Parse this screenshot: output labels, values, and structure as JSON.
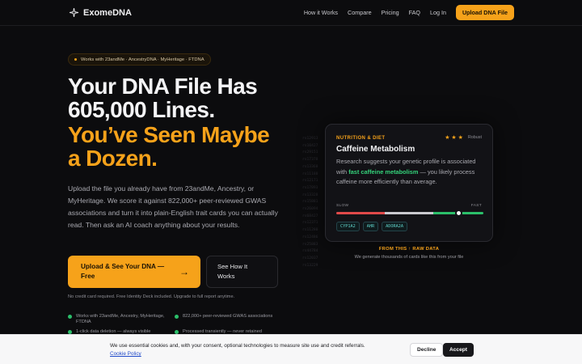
{
  "nav": {
    "brand": "ExomeDNA",
    "links": [
      "How it Works",
      "Compare",
      "Pricing",
      "FAQ",
      "Log In"
    ],
    "cta": "Upload DNA File"
  },
  "hero": {
    "badge": "Works with 23andMe · AncestryDNA · MyHeritage · FTDNA",
    "title_line1": "Your DNA File Has",
    "title_line2": "605,000 Lines.",
    "accent_line1": "You’ve Seen Maybe",
    "accent_line2": "a Dozen.",
    "lede": "Upload the file you already have from 23andMe, Ancestry, or MyHeritage. We score it against 822,000+ peer-reviewed GWAS associations and turn it into plain-English trait cards you can actually read. Then ask an AI coach anything about your results.",
    "primary_cta": "Upload & See Your DNA — Free",
    "secondary_cta": "See How It Works",
    "note": "No credit card required. Free Identity Deck included. Upgrade to full report anytime.",
    "bullets": [
      "Works with 23andMe, Ancestry, MyHeritage, FTDNA",
      "822,000+ peer-reviewed GWAS associations",
      "1-click data deletion — always visible",
      "Processed transiently — never retained"
    ]
  },
  "raw_lines": [
    "rs12913",
    "rs10427",
    "rs29151",
    "rs17378",
    "rs13368",
    "rs11180",
    "rs12171",
    "rs17893",
    "rs13328",
    "rs15881",
    "rs26094",
    "rs68427",
    "rs12371",
    "rs11280",
    "rs12486",
    "rs25883",
    "rs44784",
    "rs12037",
    "rs13229"
  ],
  "card": {
    "category": "NUTRITION & DIET",
    "stars": "★ ★ ★",
    "robust": "Robust",
    "title": "Caffeine Metabolism",
    "desc_before": "Research suggests your genetic profile is associated with ",
    "desc_highlight": "fast caffeine metabolism",
    "desc_after": " — you likely process caffeine more efficiently than average.",
    "slow_label": "SLOW",
    "fast_label": "FAST",
    "level": 0.83,
    "genes": [
      "CYP1A2",
      "AHR",
      "ADORA2A"
    ]
  },
  "raw_caption": "FROM THIS ↑ RAW DATA",
  "raw_subcaption": "We generate thousands of cards like this from your file",
  "cookie": {
    "text": "We use essential cookies and, with your consent, optional technologies to measure site use and credit referrals.",
    "link": "Cookie Policy",
    "decline": "Decline",
    "accept": "Accept"
  },
  "colors": {
    "accent": "#f6a21a",
    "positive": "#2bbf6a",
    "negative": "#e04a4a"
  }
}
